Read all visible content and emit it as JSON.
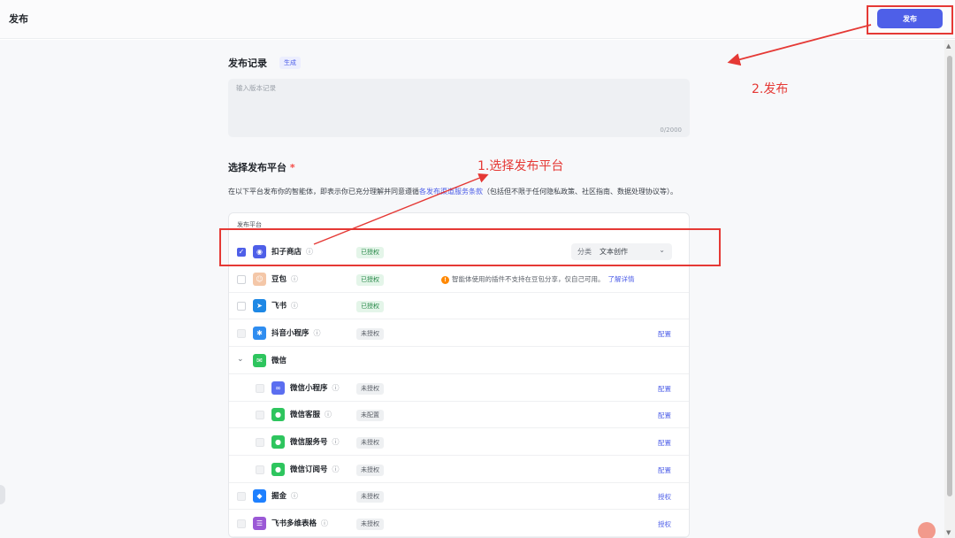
{
  "header": {
    "title": "发布",
    "publish_label": "发布"
  },
  "record": {
    "title": "发布记录",
    "generate_label": "生成",
    "placeholder": "输入版本记录",
    "counter": "0/2000"
  },
  "platforms": {
    "title": "选择发布平台",
    "required_mark": "*",
    "desc_before": "在以下平台发布你的智能体，即表示你已充分理解并同意遵循",
    "desc_link": "各发布渠道服务条款",
    "desc_after": "（包括但不限于任何隐私政策、社区指南、数据处理协议等）。",
    "column_header": "发布平台",
    "category_label": "分类",
    "category_value": "文本创作",
    "warning_text": "智能体使用的插件不支持在豆包分享，仅自己可用。",
    "warning_link": "了解详情",
    "rows": [
      {
        "name": "扣子商店",
        "status": "已授权",
        "action": "",
        "checked": true,
        "icon": "coze-store-icon",
        "color": "#4e5fe8",
        "glyph": "◉"
      },
      {
        "name": "豆包",
        "status": "已授权",
        "action": "",
        "checked": false,
        "icon": "doubao-icon",
        "color": "#f4c7a8",
        "glyph": "☺"
      },
      {
        "name": "飞书",
        "status": "已授权",
        "action": "",
        "checked": false,
        "icon": "feishu-icon",
        "color": "#1e88e5",
        "glyph": "➤"
      },
      {
        "name": "抖音小程序",
        "status": "未授权",
        "action": "配置",
        "checked": false,
        "icon": "douyin-miniprogram-icon",
        "color": "#2f8df0",
        "glyph": "✱"
      },
      {
        "name": "微信",
        "status": "",
        "action": "",
        "checked": false,
        "icon": "wechat-icon",
        "color": "#2ec55e",
        "glyph": "✉",
        "group": true
      },
      {
        "name": "微信小程序",
        "status": "未授权",
        "action": "配置",
        "checked": false,
        "icon": "wechat-miniprogram-icon",
        "color": "#5b6ef0",
        "glyph": "∞",
        "child": true
      },
      {
        "name": "微信客服",
        "status": "未配置",
        "action": "配置",
        "checked": false,
        "icon": "wechat-service-icon",
        "color": "#2ec55e",
        "glyph": "●",
        "child": true
      },
      {
        "name": "微信服务号",
        "status": "未授权",
        "action": "配置",
        "checked": false,
        "icon": "wechat-service-account-icon",
        "color": "#2ec55e",
        "glyph": "●",
        "child": true
      },
      {
        "name": "微信订阅号",
        "status": "未授权",
        "action": "配置",
        "checked": false,
        "icon": "wechat-subscription-icon",
        "color": "#2ec55e",
        "glyph": "●",
        "child": true
      },
      {
        "name": "掘金",
        "status": "未授权",
        "action": "授权",
        "checked": false,
        "icon": "juejin-icon",
        "color": "#1e80ff",
        "glyph": "◆"
      },
      {
        "name": "飞书多维表格",
        "status": "未授权",
        "action": "授权",
        "checked": false,
        "icon": "feishu-bitable-icon",
        "color": "#9b59d6",
        "glyph": "☰"
      }
    ]
  },
  "annotations": {
    "step1": "1.选择发布平台",
    "step2": "2.发布",
    "color": "#e53935"
  }
}
